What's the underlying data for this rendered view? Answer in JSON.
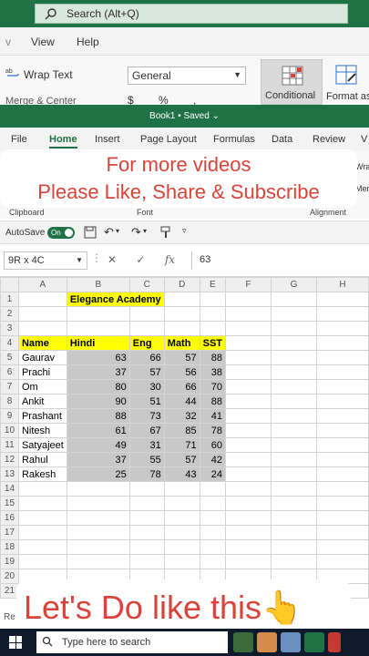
{
  "search": {
    "placeholder": "Search (Alt+Q)"
  },
  "old_ribbon": {
    "tabs": [
      "View",
      "Help"
    ],
    "wrap_text": "Wrap Text",
    "merge_center": "Merge & Center",
    "number_format": "General",
    "num_symbols": "$ % ,",
    "conditional": "Conditional",
    "format_as": "Format as"
  },
  "window": {
    "title": "Book1 • Saved ⌄"
  },
  "tabs": [
    "File",
    "Home",
    "Insert",
    "Page Layout",
    "Formulas",
    "Data",
    "Review",
    "V"
  ],
  "ribbon_groups": {
    "clipboard": "Clipboard",
    "font": "Font",
    "alignment": "Alignment",
    "wrap": "Wra",
    "merge": "Mer"
  },
  "banner_top": {
    "line1": "For more videos",
    "line2": "Please Like, Share & Subscribe"
  },
  "autosave": {
    "label": "AutoSave",
    "state": "On"
  },
  "formula": {
    "name_box": "9R x 4C",
    "fx": "fx",
    "value": "63"
  },
  "columns": [
    "A",
    "B",
    "C",
    "D",
    "E",
    "F",
    "G",
    "H"
  ],
  "title_cell": "Elegance Academy",
  "headers": [
    "Name",
    "Hindi",
    "Eng",
    "Math",
    "SST"
  ],
  "rows": [
    [
      "Gaurav",
      "63",
      "66",
      "57",
      "88"
    ],
    [
      "Prachi",
      "37",
      "57",
      "56",
      "38"
    ],
    [
      "Om",
      "80",
      "30",
      "66",
      "70"
    ],
    [
      "Ankit",
      "90",
      "51",
      "44",
      "88"
    ],
    [
      "Prashant",
      "88",
      "73",
      "32",
      "41"
    ],
    [
      "Nitesh",
      "61",
      "67",
      "85",
      "78"
    ],
    [
      "Satyajeet",
      "49",
      "31",
      "71",
      "60"
    ],
    [
      "Rahul",
      "37",
      "55",
      "57",
      "42"
    ],
    [
      "Rakesh",
      "25",
      "78",
      "43",
      "24"
    ]
  ],
  "row_numbers": [
    "1",
    "2",
    "3",
    "4",
    "5",
    "6",
    "7",
    "8",
    "9",
    "10",
    "11",
    "12",
    "13",
    "14",
    "15",
    "16",
    "17",
    "18",
    "19",
    "20",
    "21"
  ],
  "banner_bottom": {
    "text": "Let's Do like this👆"
  },
  "status": {
    "left": "Re"
  },
  "taskbar": {
    "search": "Type here to search"
  }
}
